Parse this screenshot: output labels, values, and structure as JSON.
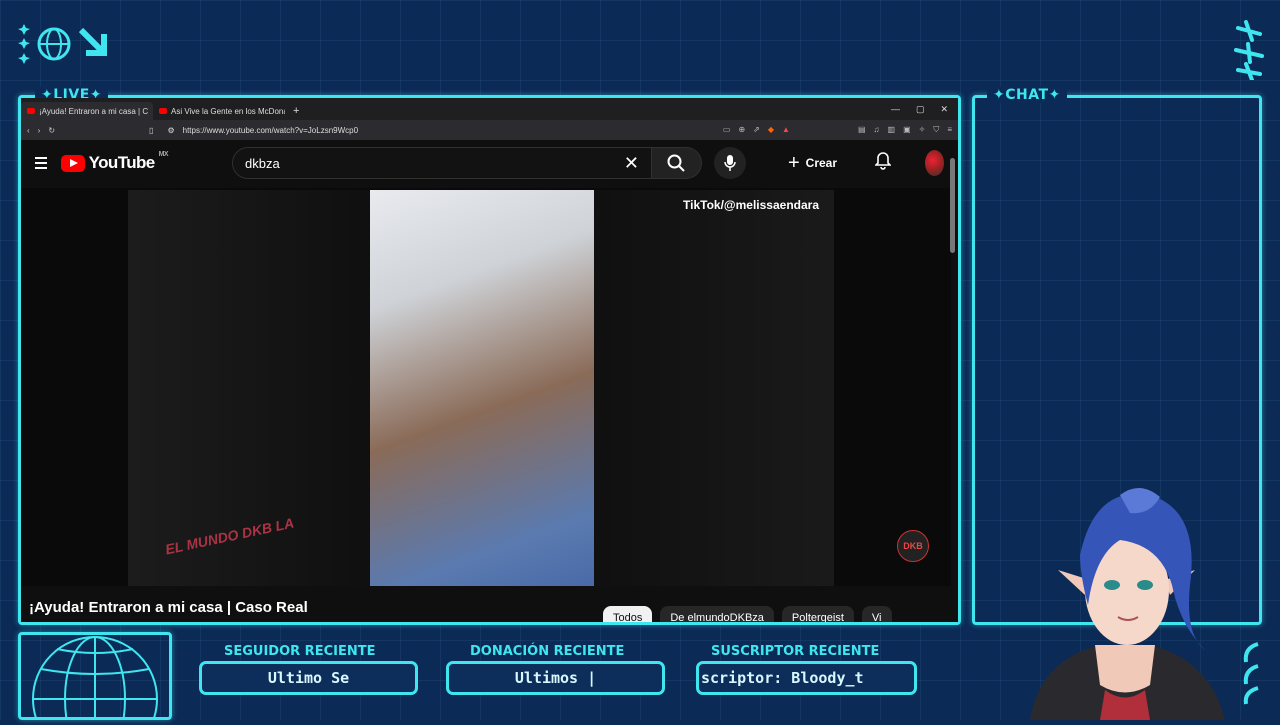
{
  "overlay": {
    "live_label": "✦LIVE✦",
    "chat_label": "✦CHAT✦",
    "bottom": [
      {
        "label": "SEGUIDOR RECIENTE",
        "value": "Ultimo Se"
      },
      {
        "label": "DONACIÓN RECIENTE",
        "value": "Ultimos |"
      },
      {
        "label": "SUSCRIPTOR RECIENTE",
        "value": "scriptor: Bloody_t"
      }
    ],
    "accent_color": "#3fe6f0"
  },
  "browser": {
    "tabs": [
      {
        "title": "¡Ayuda! Entraron a mi casa | C",
        "active": true
      },
      {
        "title": "Asi Vive la Gente en los McDonalds",
        "active": false
      }
    ],
    "new_tab_symbol": "+",
    "url": "https://www.youtube.com/watch?v=JoLzsn9Wcp0"
  },
  "youtube": {
    "logo_text": "YouTube",
    "country": "MX",
    "search_value": "dkbza",
    "create_label": "Crear",
    "video_title": "¡Ayuda! Entraron a mi casa | Caso Real",
    "watermark_tiktok": "TikTok/@melissaendara",
    "watermark_logo": "EL MUNDO DKB LA",
    "watermark_badge": "DKB",
    "chips": [
      "Todos",
      "De elmundoDKBza",
      "Poltergeist",
      "Vi"
    ]
  }
}
